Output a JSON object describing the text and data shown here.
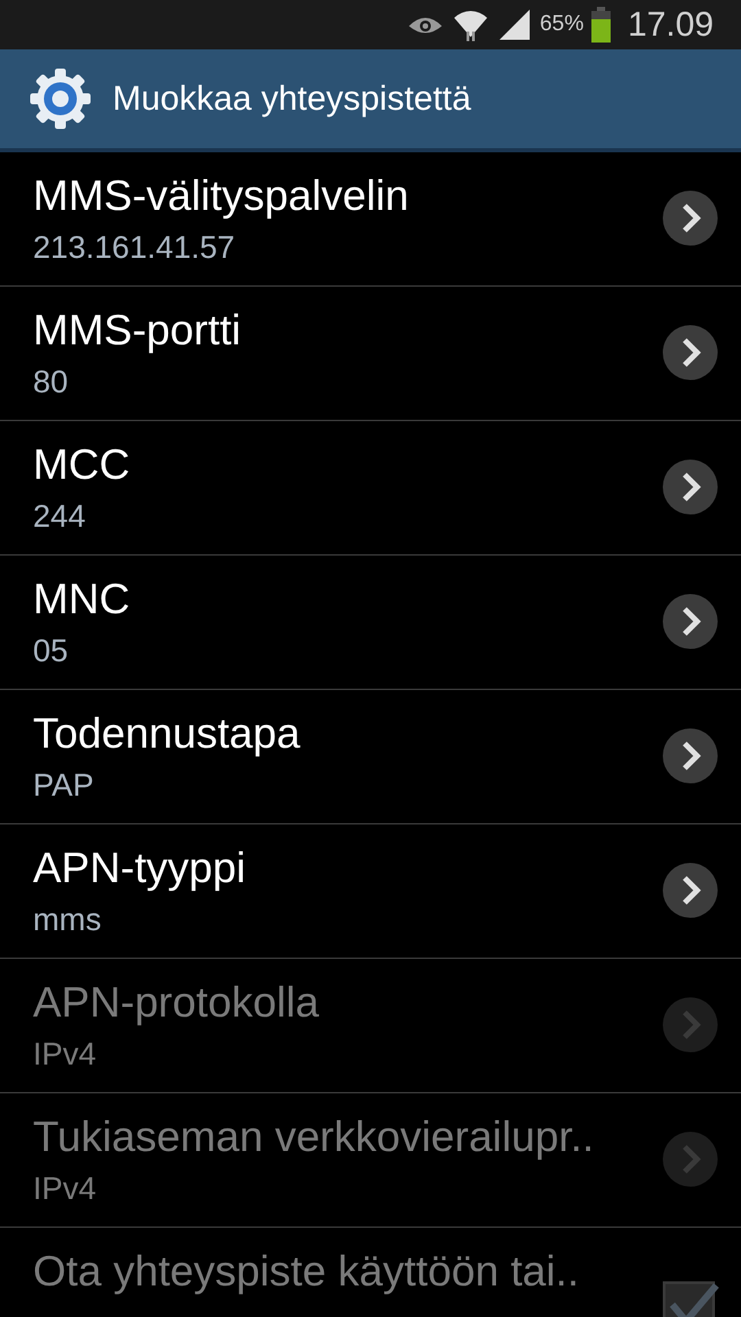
{
  "status_bar": {
    "battery": "65%",
    "time": "17.09"
  },
  "header": {
    "title": "Muokkaa yhteyspistettä"
  },
  "settings": [
    {
      "kind": "nav",
      "title": "MMS-välityspalvelin",
      "value": "213.161.41.57",
      "disabled": false
    },
    {
      "kind": "nav",
      "title": "MMS-portti",
      "value": "80",
      "disabled": false
    },
    {
      "kind": "nav",
      "title": "MCC",
      "value": "244",
      "disabled": false
    },
    {
      "kind": "nav",
      "title": "MNC",
      "value": "05",
      "disabled": false
    },
    {
      "kind": "nav",
      "title": "Todennustapa",
      "value": "PAP",
      "disabled": false
    },
    {
      "kind": "nav",
      "title": "APN-tyyppi",
      "value": "mms",
      "disabled": false
    },
    {
      "kind": "nav",
      "title": "APN-protokolla",
      "value": "IPv4",
      "disabled": true
    },
    {
      "kind": "nav",
      "title": "Tukiaseman verkkovierailupr..",
      "value": "IPv4",
      "disabled": true
    },
    {
      "kind": "checkbox",
      "title": "Ota yhteyspiste käyttöön tai..",
      "checked": true,
      "disabled": true
    }
  ]
}
